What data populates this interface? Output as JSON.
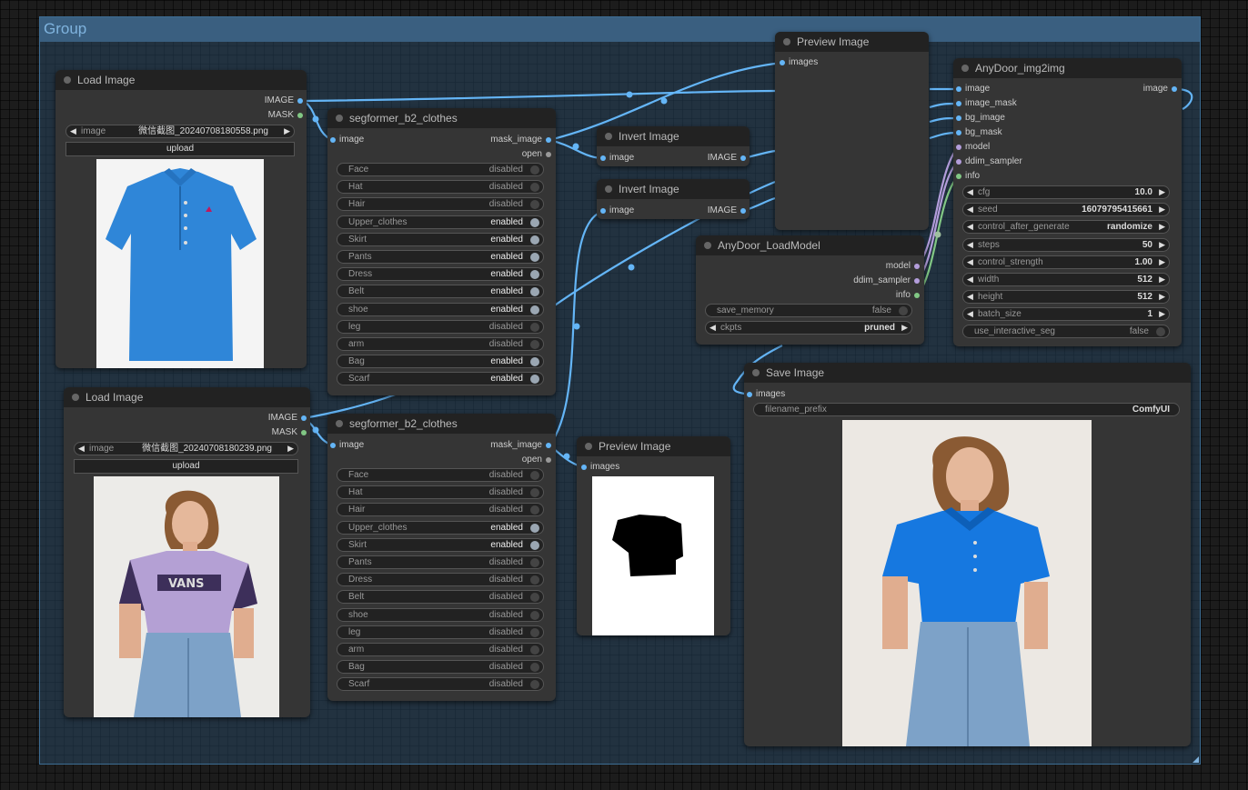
{
  "group": {
    "title": "Group"
  },
  "load_image_1": {
    "title": "Load Image",
    "outputs": [
      "IMAGE",
      "MASK"
    ],
    "image_label": "image",
    "image_value": "微信截图_20240708180558.png",
    "upload_label": "upload",
    "preview_desc": "blue polo shirt"
  },
  "load_image_2": {
    "title": "Load Image",
    "outputs": [
      "IMAGE",
      "MASK"
    ],
    "image_label": "image",
    "image_value": "微信截图_20240708180239.png",
    "upload_label": "upload",
    "preview_desc": "woman in lavender VANS t-shirt and jeans"
  },
  "segformer_1": {
    "title": "segformer_b2_clothes",
    "input": "image",
    "outputs": [
      "mask_image",
      "open"
    ],
    "params": [
      {
        "label": "Face",
        "value": "disabled"
      },
      {
        "label": "Hat",
        "value": "disabled"
      },
      {
        "label": "Hair",
        "value": "disabled"
      },
      {
        "label": "Upper_clothes",
        "value": "enabled"
      },
      {
        "label": "Skirt",
        "value": "enabled"
      },
      {
        "label": "Pants",
        "value": "enabled"
      },
      {
        "label": "Dress",
        "value": "enabled"
      },
      {
        "label": "Belt",
        "value": "enabled"
      },
      {
        "label": "shoe",
        "value": "enabled"
      },
      {
        "label": "leg",
        "value": "disabled"
      },
      {
        "label": "arm",
        "value": "disabled"
      },
      {
        "label": "Bag",
        "value": "enabled"
      },
      {
        "label": "Scarf",
        "value": "enabled"
      }
    ]
  },
  "segformer_2": {
    "title": "segformer_b2_clothes",
    "input": "image",
    "outputs": [
      "mask_image",
      "open"
    ],
    "params": [
      {
        "label": "Face",
        "value": "disabled"
      },
      {
        "label": "Hat",
        "value": "disabled"
      },
      {
        "label": "Hair",
        "value": "disabled"
      },
      {
        "label": "Upper_clothes",
        "value": "enabled"
      },
      {
        "label": "Skirt",
        "value": "enabled"
      },
      {
        "label": "Pants",
        "value": "disabled"
      },
      {
        "label": "Dress",
        "value": "disabled"
      },
      {
        "label": "Belt",
        "value": "disabled"
      },
      {
        "label": "shoe",
        "value": "disabled"
      },
      {
        "label": "leg",
        "value": "disabled"
      },
      {
        "label": "arm",
        "value": "disabled"
      },
      {
        "label": "Bag",
        "value": "disabled"
      },
      {
        "label": "Scarf",
        "value": "disabled"
      }
    ]
  },
  "invert_1": {
    "title": "Invert Image",
    "input": "image",
    "output": "IMAGE"
  },
  "invert_2": {
    "title": "Invert Image",
    "input": "image",
    "output": "IMAGE"
  },
  "preview_top": {
    "title": "Preview Image",
    "input": "images"
  },
  "preview_mask": {
    "title": "Preview Image",
    "input": "images"
  },
  "anydoor_load": {
    "title": "AnyDoor_LoadModel",
    "outputs": [
      "model",
      "ddim_sampler",
      "info"
    ],
    "save_memory_label": "save_memory",
    "save_memory_value": "false",
    "ckpts_label": "ckpts",
    "ckpts_value": "pruned"
  },
  "anydoor_img2img": {
    "title": "AnyDoor_img2img",
    "inputs": [
      "image",
      "image_mask",
      "bg_image",
      "bg_mask",
      "model",
      "ddim_sampler",
      "info"
    ],
    "output": "image",
    "params": [
      {
        "label": "cfg",
        "value": "10.0"
      },
      {
        "label": "seed",
        "value": "16079795415661"
      },
      {
        "label": "control_after_generate",
        "value": "randomize"
      },
      {
        "label": "steps",
        "value": "50"
      },
      {
        "label": "control_strength",
        "value": "1.00"
      },
      {
        "label": "width",
        "value": "512"
      },
      {
        "label": "height",
        "value": "512"
      },
      {
        "label": "batch_size",
        "value": "1"
      }
    ],
    "toggle_label": "use_interactive_seg",
    "toggle_value": "false"
  },
  "save_image": {
    "title": "Save Image",
    "input": "images",
    "prefix_label": "filename_prefix",
    "prefix_value": "ComfyUI",
    "preview_desc": "woman in blue polo shirt and jeans"
  },
  "colors": {
    "image_link": "#64b5f6",
    "mask_link": "#81c784",
    "model_link": "#b39ddb",
    "group_bg": "#3a5f80",
    "node_bg": "#353535"
  }
}
